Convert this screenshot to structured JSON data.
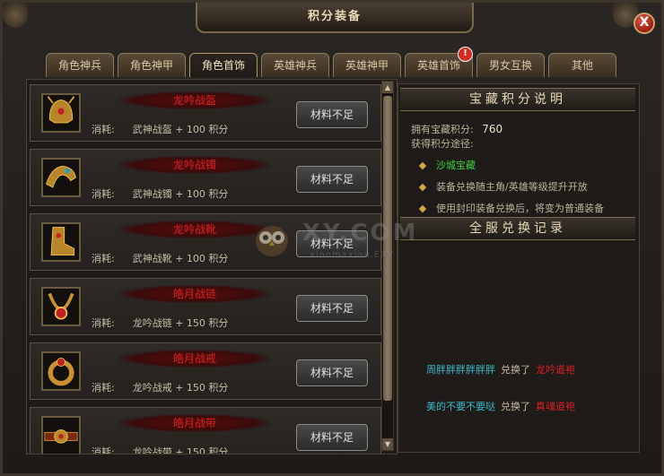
{
  "window": {
    "title": "积分装备",
    "close_label": "X"
  },
  "tabs": [
    {
      "label": "角色神兵",
      "active": false
    },
    {
      "label": "角色神甲",
      "active": false
    },
    {
      "label": "角色首饰",
      "active": true
    },
    {
      "label": "英雄神兵",
      "active": false
    },
    {
      "label": "英雄神甲",
      "active": false
    },
    {
      "label": "英雄首饰",
      "active": false,
      "badge": "!"
    },
    {
      "label": "男女互换",
      "active": false
    },
    {
      "label": "其他",
      "active": false
    }
  ],
  "items": [
    {
      "name": "龙吟战盔",
      "cost_label": "消耗:",
      "cost_item": "武神战盔",
      "cost_points": "+ 100 积分",
      "button": "材料不足",
      "icon": "helmet-icon"
    },
    {
      "name": "龙吟战镯",
      "cost_label": "消耗:",
      "cost_item": "武神战镯",
      "cost_points": "+ 100 积分",
      "button": "材料不足",
      "icon": "bracelet-icon"
    },
    {
      "name": "龙吟战靴",
      "cost_label": "消耗:",
      "cost_item": "武神战靴",
      "cost_points": "+ 100 积分",
      "button": "材料不足",
      "icon": "boots-icon"
    },
    {
      "name": "皓月战链",
      "cost_label": "消耗:",
      "cost_item": "龙吟战链",
      "cost_points": "+ 150 积分",
      "button": "材料不足",
      "icon": "necklace-icon"
    },
    {
      "name": "皓月战戒",
      "cost_label": "消耗:",
      "cost_item": "龙吟战戒",
      "cost_points": "+ 150 积分",
      "button": "材料不足",
      "icon": "ring-icon"
    },
    {
      "name": "皓月战带",
      "cost_label": "消耗:",
      "cost_item": "龙吟战带",
      "cost_points": "+ 150 积分",
      "button": "材料不足",
      "icon": "belt-icon"
    }
  ],
  "info": {
    "header": "宝藏积分说明",
    "points_label": "拥有宝藏积分:",
    "points_value": "760",
    "sources_label": "获得积分途径:",
    "bullets": [
      {
        "text": "沙城宝藏",
        "color": "green"
      },
      {
        "text": "装备兑换随主角/英雄等级提升开放",
        "color": "normal"
      },
      {
        "text": "使用封印装备兑换后，将变为普通装备",
        "color": "normal"
      }
    ]
  },
  "records": {
    "header": "全服兑换记录",
    "entries": [
      {
        "player": "周胖胖胖胖胖胖",
        "verb": "兑换了",
        "item": "龙吟道袍"
      },
      {
        "player": "美的不要不要哒",
        "verb": "兑换了",
        "item": "真魂道袍"
      }
    ]
  },
  "watermark": {
    "main": "XY.COM",
    "sub": "xiaomaxiao.EXY"
  },
  "colors": {
    "item_name": "#d42020",
    "green": "#3cd040",
    "player": "#3cb8c8",
    "record_item": "#e02020",
    "title": "#e8d9b8"
  }
}
